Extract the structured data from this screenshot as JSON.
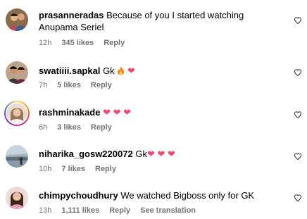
{
  "comments": [
    {
      "username": "prasanneradas",
      "text": "Because of you I started watching Anupama Seriel",
      "time": "12h",
      "likes": "345 likes",
      "reply": "Reply"
    },
    {
      "username": "swatiiii.sapkal",
      "text": "Gk",
      "emojis": [
        "fire",
        "heart"
      ],
      "time": "7h",
      "likes": "5 likes",
      "reply": "Reply"
    },
    {
      "username": "rashminakade",
      "text": "",
      "emojis": [
        "heart",
        "heart",
        "heart"
      ],
      "time": "6h",
      "likes": "3 likes",
      "reply": "Reply"
    },
    {
      "username": "niharika_gosw220072",
      "text": "Gk",
      "emojis": [
        "heart",
        "heart",
        "heart"
      ],
      "time": "10h",
      "likes": "7 likes",
      "reply": "Reply"
    },
    {
      "username": "chimpychoudhury",
      "text": "We watched Bigboss only for GK",
      "time": "13h",
      "likes": "1,111 likes",
      "reply": "Reply",
      "see_translation": "See translation"
    }
  ],
  "icons": {
    "like": "heart-outline-icon",
    "emoji_heart": "red-heart-emoji",
    "emoji_fire": "fire-emoji"
  },
  "colors": {
    "heart_emoji": "#f0466e",
    "meta_text": "#737373"
  }
}
